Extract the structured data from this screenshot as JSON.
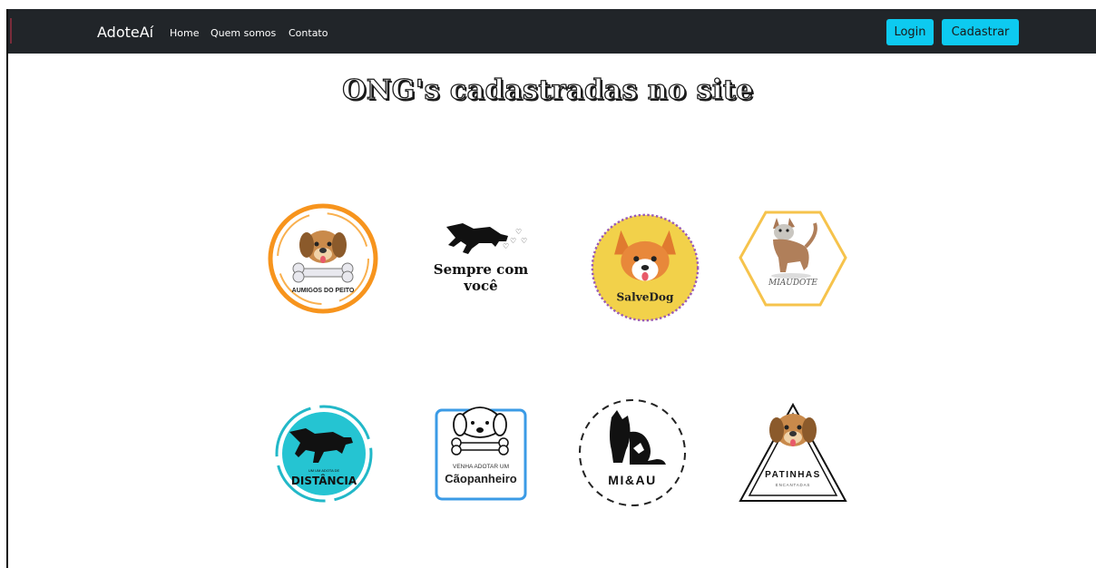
{
  "nav": {
    "brand": "AdoteAí",
    "links": [
      "Home",
      "Quem somos",
      "Contato"
    ],
    "login_label": "Login",
    "register_label": "Cadastrar"
  },
  "page": {
    "title": "ONG's cadastradas no site"
  },
  "ongs": [
    {
      "name": "AUMIGOS DO PEITO",
      "icon": "dog-bone-icon",
      "accent": "#f7941d"
    },
    {
      "name_line1": "Sempre com",
      "name_line2": "você",
      "icon": "running-dog-icon"
    },
    {
      "name": "SalveDog",
      "icon": "corgi-icon",
      "accent": "#f2d14a"
    },
    {
      "name": "MIAUDOTE",
      "icon": "cat-icon",
      "accent": "#f6c34c"
    },
    {
      "name_small": "UM UM ADOTA DE",
      "name": "DISTÂNCIA",
      "icon": "dog-silhouette-icon",
      "accent": "#22b8c8"
    },
    {
      "name_small": "VENHA ADOTAR UM",
      "name": "Cãopanheiro",
      "icon": "dog-bone-outline-icon",
      "accent": "#3b9be6"
    },
    {
      "name": "MI&AU",
      "icon": "cat-dog-silhouette-icon"
    },
    {
      "name": "PATINHAS",
      "name_small": "ENCANTADAS",
      "icon": "dog-triangle-icon"
    }
  ],
  "colors": {
    "navbar": "#212529",
    "button": "#0dcaf0"
  }
}
